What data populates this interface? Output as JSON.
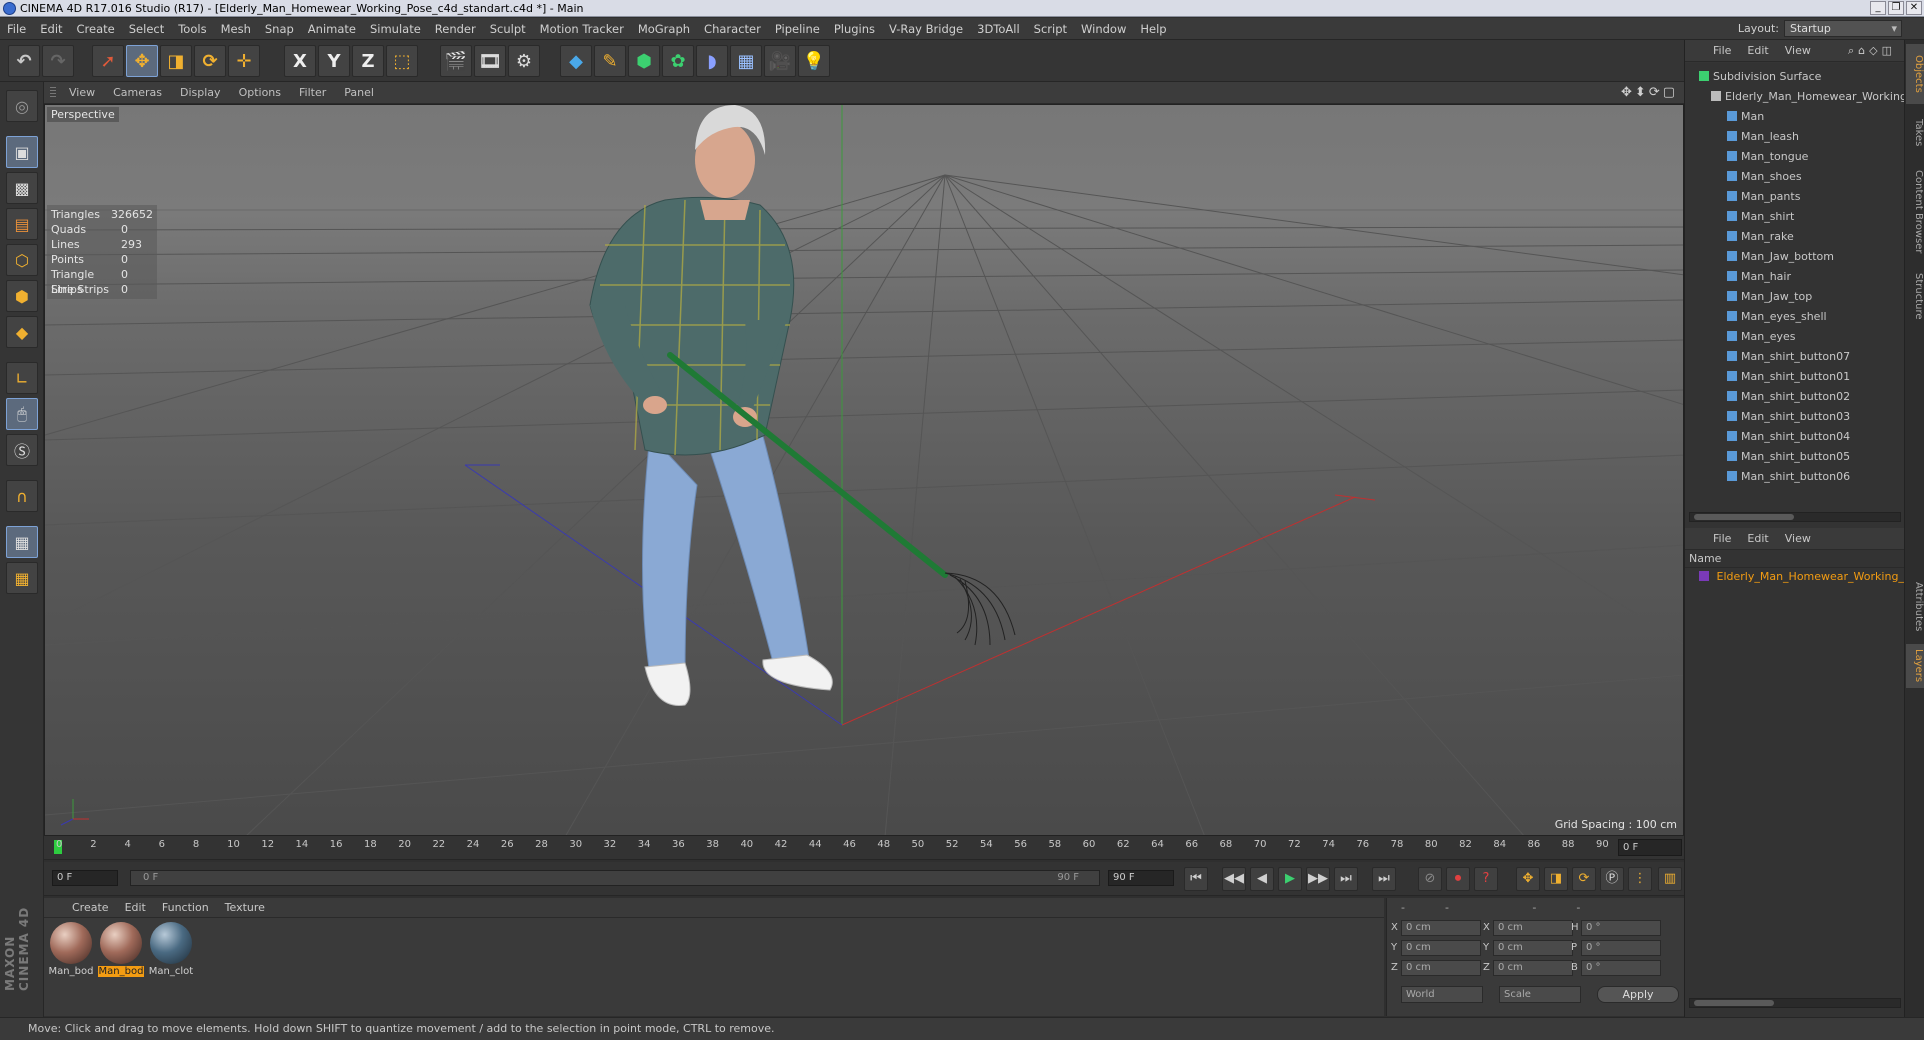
{
  "titlebar": {
    "title": "CINEMA 4D R17.016 Studio (R17) - [Elderly_Man_Homewear_Working_Pose_c4d_standart.c4d *] - Main",
    "buttons": [
      "_",
      "❐",
      "✕"
    ]
  },
  "menu": [
    "File",
    "Edit",
    "Create",
    "Select",
    "Tools",
    "Mesh",
    "Snap",
    "Animate",
    "Simulate",
    "Render",
    "Sculpt",
    "Motion Tracker",
    "MoGraph",
    "Character",
    "Pipeline",
    "Plugins",
    "V-Ray Bridge",
    "3DToAll",
    "Script",
    "Window",
    "Help"
  ],
  "layout": {
    "label": "Layout:",
    "value": "Startup"
  },
  "toolbar": {
    "undo": "↶",
    "redo": "↷",
    "x": "X",
    "y": "Y",
    "z": "Z"
  },
  "viewport": {
    "menu": [
      "View",
      "Cameras",
      "Display",
      "Options",
      "Filter",
      "Panel"
    ],
    "camera_label": "Perspective",
    "nav_icons": "✥⬍⟳▢",
    "stats": [
      {
        "k": "Triangles",
        "v": "326652"
      },
      {
        "k": "Quads",
        "v": "0"
      },
      {
        "k": "Lines",
        "v": "293"
      },
      {
        "k": "Points",
        "v": "0"
      },
      {
        "k": "Triangle Strips",
        "v": "0"
      },
      {
        "k": "Line Strips",
        "v": "0"
      }
    ],
    "grid_spacing": "Grid Spacing : 100 cm"
  },
  "timeline": {
    "ticks": [
      "0",
      "2",
      "4",
      "6",
      "8",
      "10",
      "12",
      "14",
      "16",
      "18",
      "20",
      "22",
      "24",
      "26",
      "28",
      "30",
      "32",
      "34",
      "36",
      "38",
      "40",
      "42",
      "44",
      "46",
      "48",
      "50",
      "52",
      "54",
      "56",
      "58",
      "60",
      "62",
      "64",
      "66",
      "68",
      "70",
      "72",
      "74",
      "76",
      "78",
      "80",
      "82",
      "84",
      "86",
      "88",
      "90"
    ],
    "current_frame": "0 F"
  },
  "transport": {
    "start": "0 F",
    "slider_start": "0 F",
    "slider_end": "90 F",
    "end": "90 F",
    "buttons": [
      "⏮",
      "◀◀",
      "◀",
      "▶",
      "▶▶",
      "⏭",
      "⏭"
    ]
  },
  "materials": {
    "menu": [
      "Create",
      "Edit",
      "Function",
      "Texture"
    ],
    "items": [
      {
        "label": "Man_bod",
        "selected": false,
        "type": "skin"
      },
      {
        "label": "Man_bod",
        "selected": true,
        "type": "skin"
      },
      {
        "label": "Man_clot",
        "selected": false,
        "type": "cloth"
      }
    ]
  },
  "coords": {
    "header": "-- -- --",
    "rows": [
      {
        "a": "X",
        "av": "0 cm",
        "b": "X",
        "bv": "0 cm",
        "c": "H",
        "cv": "0 °"
      },
      {
        "a": "Y",
        "av": "0 cm",
        "b": "Y",
        "bv": "0 cm",
        "c": "P",
        "cv": "0 °"
      },
      {
        "a": "Z",
        "av": "0 cm",
        "b": "Z",
        "bv": "0 cm",
        "c": "B",
        "cv": "0 °"
      }
    ],
    "world": "World",
    "scale": "Scale",
    "apply": "Apply"
  },
  "status": "Move: Click and drag to move elements. Hold down SHIFT to quantize movement / add to the selection in point mode, CTRL to remove.",
  "objects": {
    "menu": [
      "File",
      "Edit",
      "View"
    ],
    "root": "Subdivision Surface",
    "group": "Elderly_Man_Homewear_Working_",
    "children": [
      "Man",
      "Man_leash",
      "Man_tongue",
      "Man_shoes",
      "Man_pants",
      "Man_shirt",
      "Man_rake",
      "Man_Jaw_bottom",
      "Man_hair",
      "Man_Jaw_top",
      "Man_eyes_shell",
      "Man_eyes",
      "Man_shirt_button07",
      "Man_shirt_button01",
      "Man_shirt_button02",
      "Man_shirt_button03",
      "Man_shirt_button04",
      "Man_shirt_button05",
      "Man_shirt_button06"
    ]
  },
  "layers": {
    "menu": [
      "File",
      "Edit",
      "View"
    ],
    "column": "Name",
    "item": "Elderly_Man_Homewear_Working_Po"
  },
  "side_tabs": [
    "Objects",
    "Takes",
    "Content Browser",
    "Structure",
    "Attributes",
    "Layers"
  ],
  "colors": {
    "accent": "#f39c12",
    "selection": "#7da2d6",
    "timeline_cursor": "#2ecc40"
  }
}
